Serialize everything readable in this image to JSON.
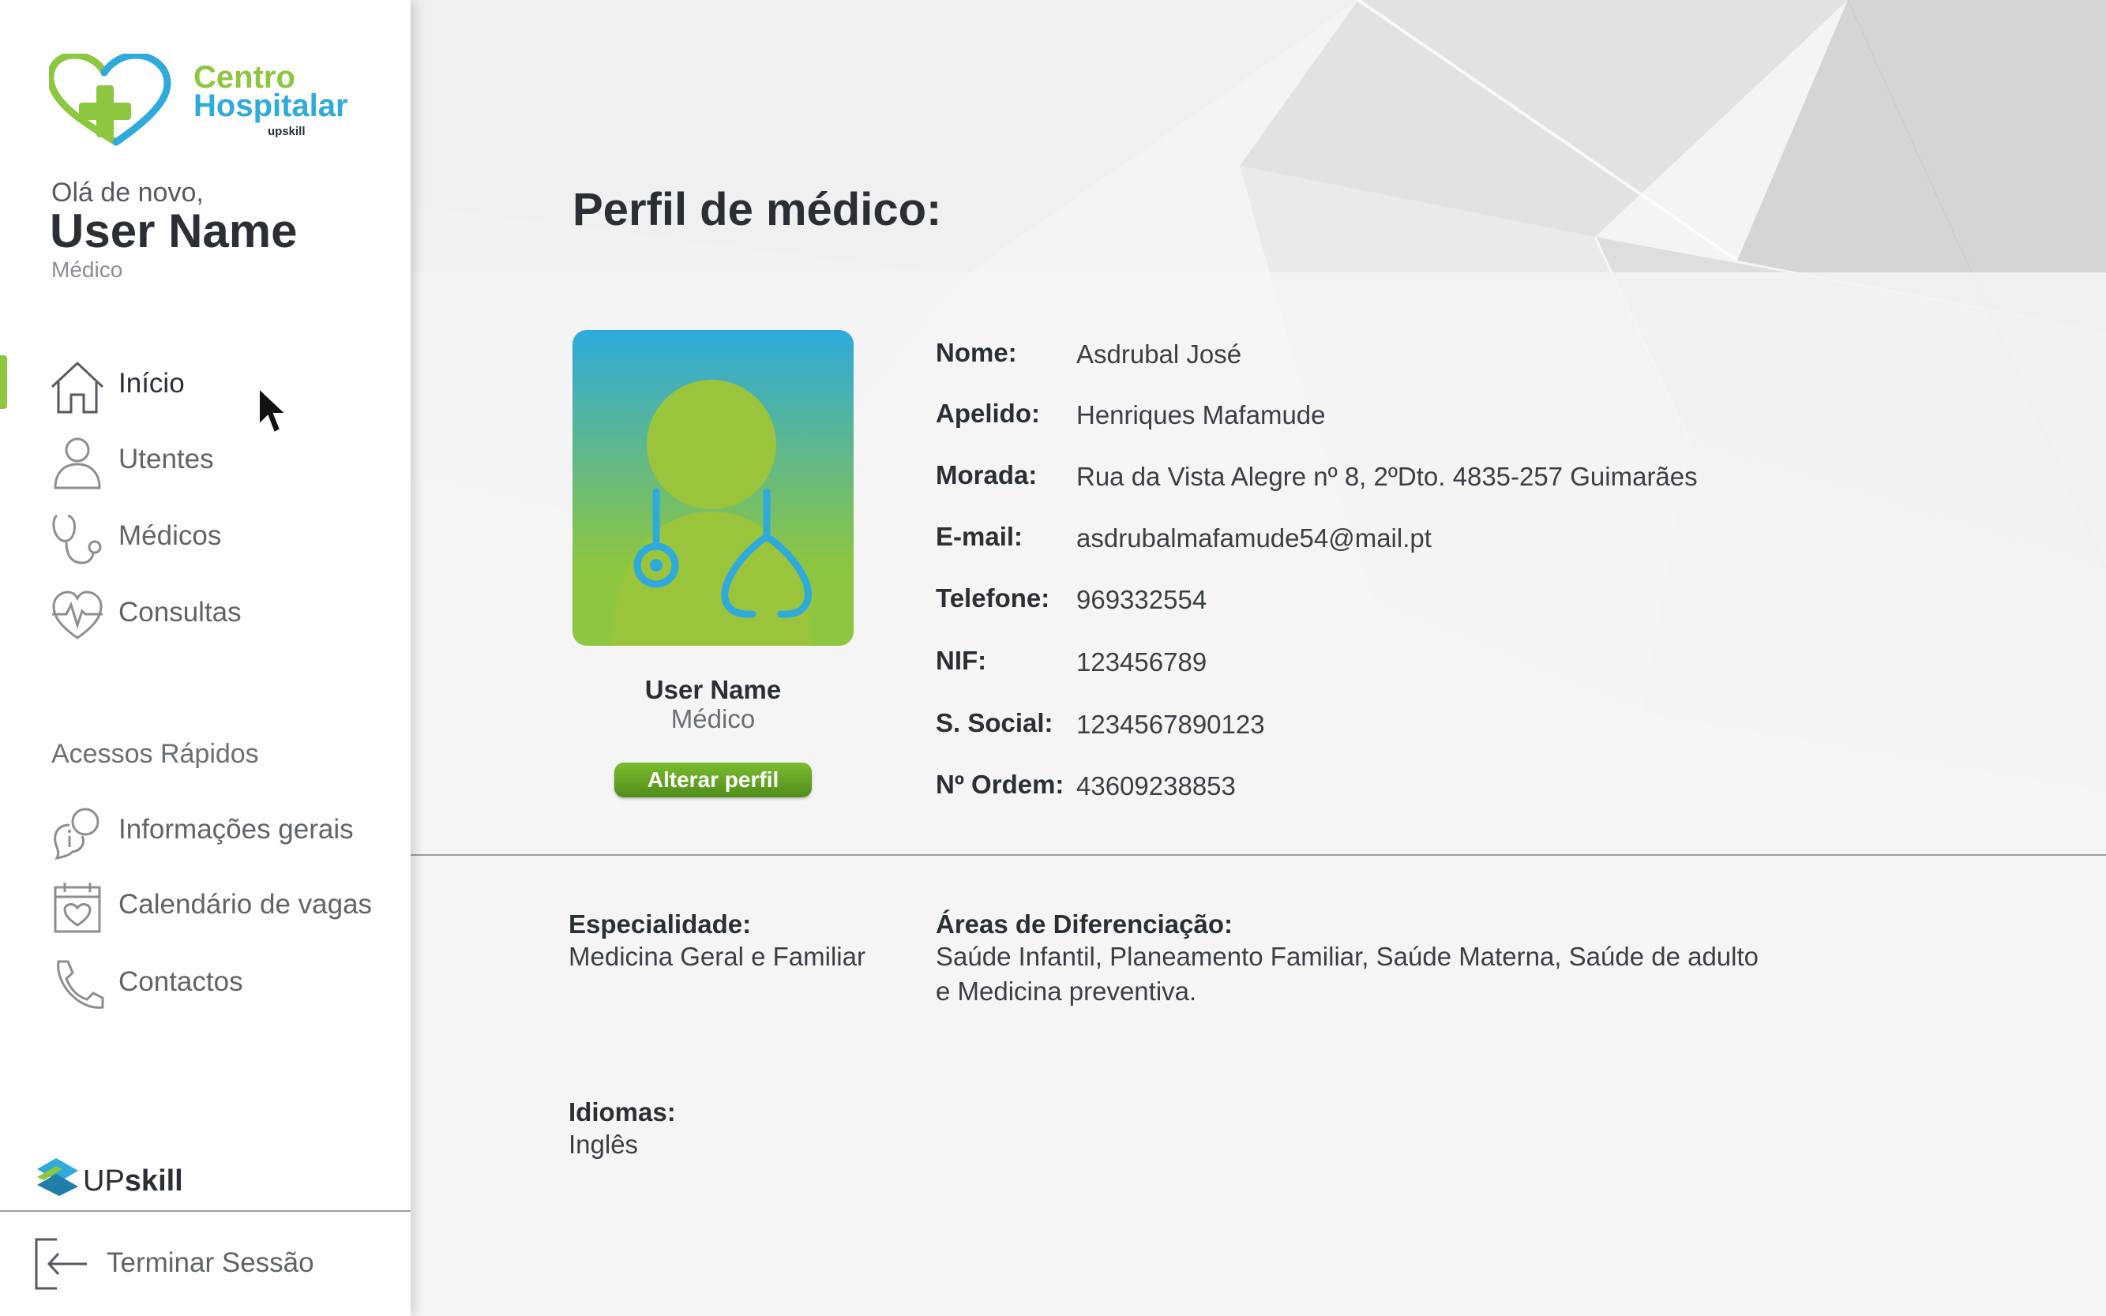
{
  "sidebar": {
    "logo": {
      "line1": "Centro",
      "line2": "Hospitalar",
      "line3": "upskill"
    },
    "greeting": "Olá de novo,",
    "user_name": "User Name",
    "user_role": "Médico",
    "nav": [
      {
        "label": "Início",
        "icon": "home-icon",
        "active": true
      },
      {
        "label": "Utentes",
        "icon": "user-icon"
      },
      {
        "label": "Médicos",
        "icon": "stethoscope-icon"
      },
      {
        "label": "Consultas",
        "icon": "heartbeat-icon"
      }
    ],
    "quick_title": "Acessos Rápidos",
    "quick": [
      {
        "label": "Informações gerais",
        "icon": "info-chat-icon"
      },
      {
        "label": "Calendário de vagas",
        "icon": "calendar-heart-icon"
      },
      {
        "label": "Contactos",
        "icon": "phone-icon"
      }
    ],
    "brand": {
      "up": "UP",
      "skill": "skill"
    },
    "logout": "Terminar Sessão"
  },
  "main": {
    "title": "Perfil de médico:",
    "card": {
      "name": "User Name",
      "role": "Médico",
      "edit_button": "Alterar perfil"
    },
    "fields": [
      {
        "key": "Nome:",
        "value": "Asdrubal José"
      },
      {
        "key": "Apelido:",
        "value": "Henriques Mafamude"
      },
      {
        "key": "Morada:",
        "value": "Rua da Vista Alegre nº 8, 2ºDto. 4835-257 Guimarães"
      },
      {
        "key": "E-mail:",
        "value": "asdrubalmafamude54@mail.pt"
      },
      {
        "key": "Telefone:",
        "value": "969332554"
      },
      {
        "key": "NIF:",
        "value": "123456789"
      },
      {
        "key": "S. Social:",
        "value": "1234567890123"
      },
      {
        "key": "Nº Ordem:",
        "value": "43609238853"
      }
    ],
    "especialidade": {
      "key": "Especialidade:",
      "value": "Medicina Geral e Familiar"
    },
    "areas": {
      "key": "Áreas de Diferenciação:",
      "line1": "Saúde Infantil, Planeamento Familiar, Saúde Materna, Saúde de adulto",
      "line2": "e Medicina preventiva."
    },
    "idiomas": {
      "key": "Idiomas:",
      "value": "Inglês"
    }
  },
  "colors": {
    "accent_green": "#8dc63f",
    "accent_blue": "#2eaadc",
    "button_green": "#5fa020"
  }
}
